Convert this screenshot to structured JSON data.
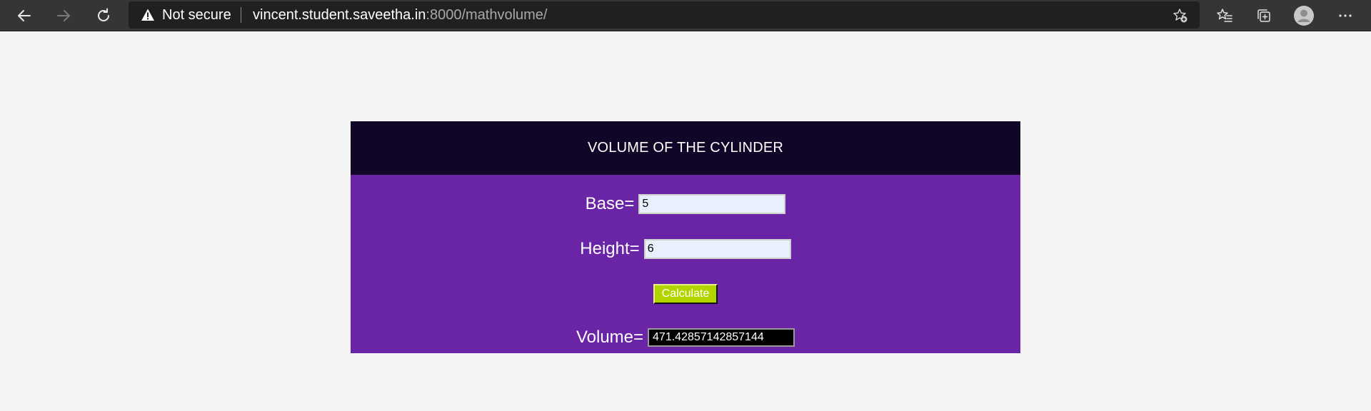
{
  "browser": {
    "security_label": "Not secure",
    "url_host": "vincent.student.saveetha.in",
    "url_rest": ":8000/mathvolume/",
    "icons": {
      "back": "back-arrow-icon",
      "forward": "forward-arrow-icon",
      "refresh": "refresh-icon",
      "warning": "warning-icon",
      "add_favorite": "add-favorite-icon",
      "favorites": "favorites-icon",
      "collections": "collections-icon",
      "profile": "profile-icon",
      "menu": "more-menu-icon"
    }
  },
  "page": {
    "header_title": "VOLUME OF THE CYLINDER",
    "base_label": "Base=",
    "base_value": "5",
    "height_label": "Height=",
    "height_value": "6",
    "calculate_label": "Calculate",
    "volume_label": "Volume=",
    "volume_value": "471.42857142857144"
  },
  "colors": {
    "header_bg": "#120628",
    "body_bg": "#6a24a6",
    "button_bg": "#b4d400",
    "input_bg": "#e8f0fe",
    "result_bg": "#000000"
  }
}
